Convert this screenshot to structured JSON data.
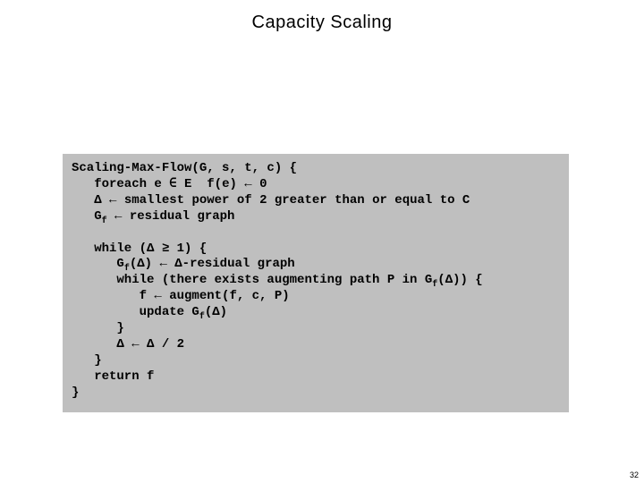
{
  "title": "Capacity Scaling",
  "page_number": "32",
  "code": {
    "l01": "Scaling-Max-Flow(G, s, t, c) {",
    "l02a": "   foreach e ",
    "l02b": " E  f(e) ",
    "l02c": " 0",
    "l03a": "   ",
    "l03b": " ",
    "l03c": " smallest power of 2 greater than or equal to C",
    "l04a": "   G",
    "l04b": " ",
    "l04c": " residual graph",
    "l05": "",
    "l06a": "   while (",
    "l06b": " ",
    "l06c": " 1) {",
    "l07a": "      G",
    "l07b": "(",
    "l07c": ") ",
    "l07d": " ",
    "l07e": "-residual graph",
    "l08a": "      while (there exists augmenting path P in G",
    "l08b": "(",
    "l08c": ")) {",
    "l09a": "         f ",
    "l09b": " augment(f, c, P)",
    "l10a": "         update G",
    "l10b": "(",
    "l10c": ")",
    "l11": "      }",
    "l12a": "      ",
    "l12b": " ",
    "l12c": " ",
    "l12d": " / 2",
    "l13": "   }",
    "l14": "   return f",
    "l15": "}"
  },
  "sym": {
    "in": "∈",
    "leftarrow": "←",
    "Delta": "Δ",
    "ge": "≥",
    "f": "f"
  }
}
